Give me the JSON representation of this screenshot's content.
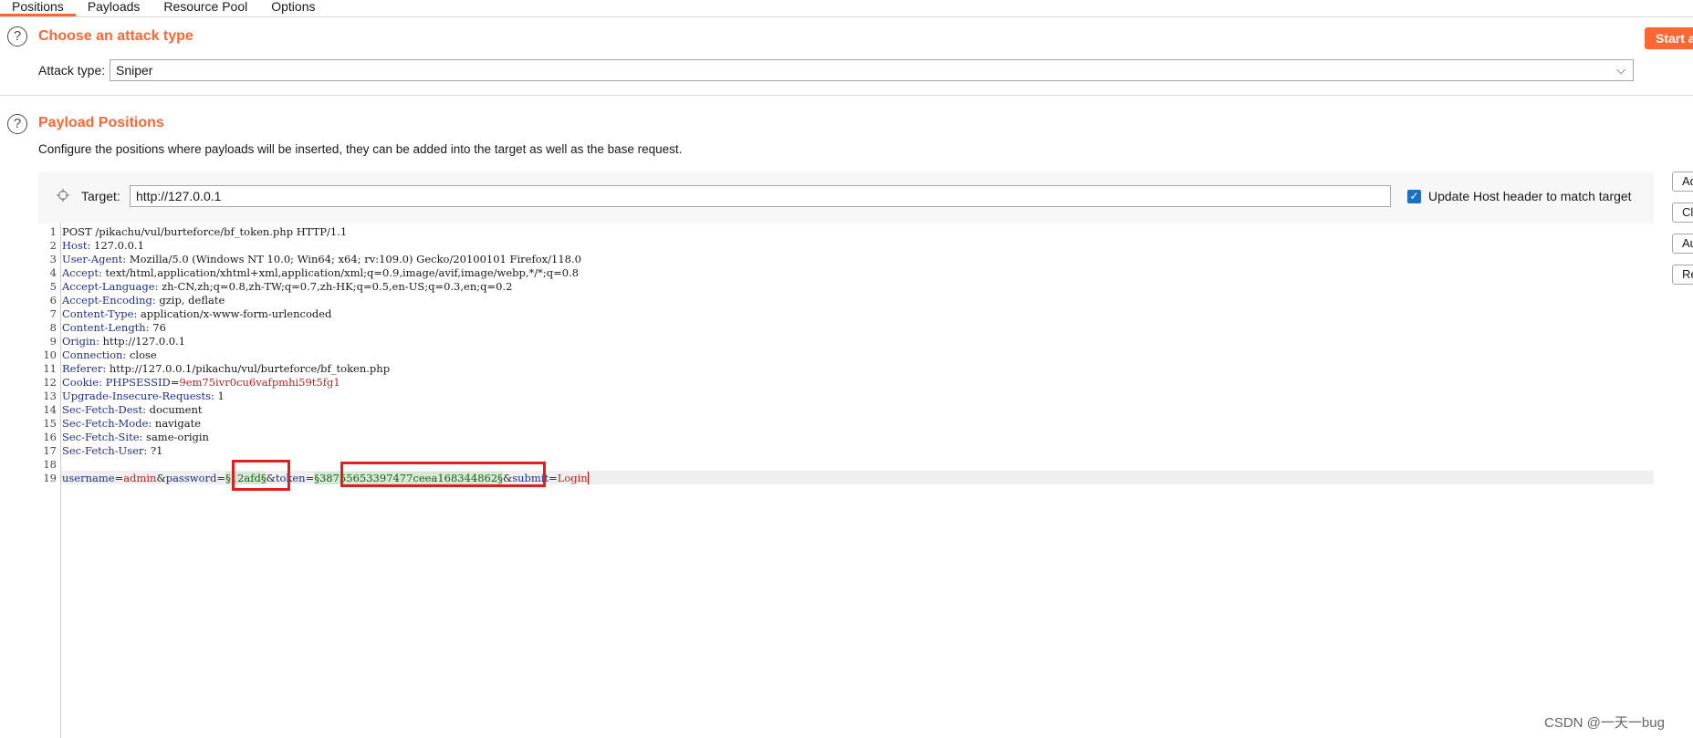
{
  "tabs": [
    "Positions",
    "Payloads",
    "Resource Pool",
    "Options"
  ],
  "attack": {
    "title": "Choose an attack type",
    "type_label": "Attack type:",
    "type_value": "Sniper",
    "start_button": "Start attack"
  },
  "positions": {
    "title": "Payload Positions",
    "description": "Configure the positions where payloads will be inserted, they can be added into the target as well as the base request.",
    "target_label": "Target:",
    "target_value": "http://127.0.0.1",
    "update_host_label": "Update Host header to match target",
    "update_host_checked": true
  },
  "side_buttons": [
    "Add §",
    "Clear §",
    "Auto §",
    "Refresh"
  ],
  "request": {
    "line1": "POST /pikachu/vul/burteforce/bf_token.php HTTP/1.1",
    "headers": [
      {
        "key": "Host",
        "value": "127.0.0.1"
      },
      {
        "key": "User-Agent",
        "value": "Mozilla/5.0 (Windows NT 10.0; Win64; x64; rv:109.0) Gecko/20100101 Firefox/118.0"
      },
      {
        "key": "Accept",
        "value": "text/html,application/xhtml+xml,application/xml;q=0.9,image/avif,image/webp,*/*;q=0.8"
      },
      {
        "key": "Accept-Language",
        "value": "zh-CN,zh;q=0.8,zh-TW;q=0.7,zh-HK;q=0.5,en-US;q=0.3,en;q=0.2"
      },
      {
        "key": "Accept-Encoding",
        "value": "gzip, deflate"
      },
      {
        "key": "Content-Type",
        "value": "application/x-www-form-urlencoded"
      },
      {
        "key": "Content-Length",
        "value": "76"
      },
      {
        "key": "Origin",
        "value": "http://127.0.0.1"
      },
      {
        "key": "Connection",
        "value": "close"
      },
      {
        "key": "Referer",
        "value": "http://127.0.0.1/pikachu/vul/burteforce/bf_token.php"
      },
      {
        "key": "Cookie",
        "value": "9em75ivr0cu6vafpmhi59t5fg1",
        "cookie_name": "PHPSESSID"
      },
      {
        "key": "Upgrade-Insecure-Requests",
        "value": "1"
      },
      {
        "key": "Sec-Fetch-Dest",
        "value": "document"
      },
      {
        "key": "Sec-Fetch-Mode",
        "value": "navigate"
      },
      {
        "key": "Sec-Fetch-Site",
        "value": "same-origin"
      },
      {
        "key": "Sec-Fetch-User",
        "value": "?1"
      }
    ],
    "body": {
      "p1_name": "username",
      "p1_value": "admin",
      "p2_name": "password",
      "p2_value": "§12afd§",
      "p3_name": "token",
      "p3_value": "§38755653397477ceea168344862§",
      "p4_name": "submit",
      "p4_value": "Login"
    }
  },
  "line_numbers": [
    "1",
    "2",
    "3",
    "4",
    "5",
    "6",
    "7",
    "8",
    "9",
    "10",
    "11",
    "12",
    "13",
    "14",
    "15",
    "16",
    "17",
    "18",
    "19"
  ],
  "watermark": "CSDN @一天一bug"
}
